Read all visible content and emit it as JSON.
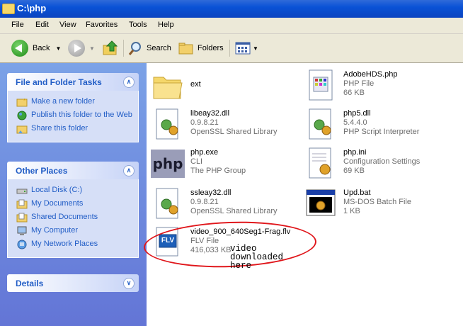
{
  "window": {
    "title": "C:\\php"
  },
  "menu": {
    "items": [
      "File",
      "Edit",
      "View",
      "Favorites",
      "Tools",
      "Help"
    ]
  },
  "toolbar": {
    "back": "Back",
    "search": "Search",
    "folders": "Folders"
  },
  "tasks_panel": {
    "title": "File and Folder Tasks",
    "items": [
      "Make a new folder",
      "Publish this folder to the Web",
      "Share this folder"
    ]
  },
  "places_panel": {
    "title": "Other Places",
    "items": [
      "Local Disk (C:)",
      "My Documents",
      "Shared Documents",
      "My Computer",
      "My Network Places"
    ]
  },
  "details_panel": {
    "title": "Details"
  },
  "files": [
    {
      "name": "ext",
      "line2": "",
      "line3": ""
    },
    {
      "name": "AdobeHDS.php",
      "line2": "PHP File",
      "line3": "66 KB"
    },
    {
      "name": "libeay32.dll",
      "line2": "0.9.8.21",
      "line3": "OpenSSL Shared Library"
    },
    {
      "name": "php5.dll",
      "line2": "5.4.4.0",
      "line3": "PHP Script Interpreter"
    },
    {
      "name": "php.exe",
      "line2": "CLI",
      "line3": "The PHP Group"
    },
    {
      "name": "php.ini",
      "line2": "Configuration Settings",
      "line3": "69 KB"
    },
    {
      "name": "ssleay32.dll",
      "line2": "0.9.8.21",
      "line3": "OpenSSL Shared Library"
    },
    {
      "name": "Upd.bat",
      "line2": "MS-DOS Batch File",
      "line3": "1 KB"
    },
    {
      "name": "video_900_640Seg1-Frag.flv",
      "line2": "FLV File",
      "line3": "416,033 KB"
    }
  ],
  "annotation": {
    "line1": "video",
    "line2": "downloaded",
    "line3": "here"
  },
  "icons": {
    "php_logo_text": "php",
    "flv_label": "FLV"
  }
}
